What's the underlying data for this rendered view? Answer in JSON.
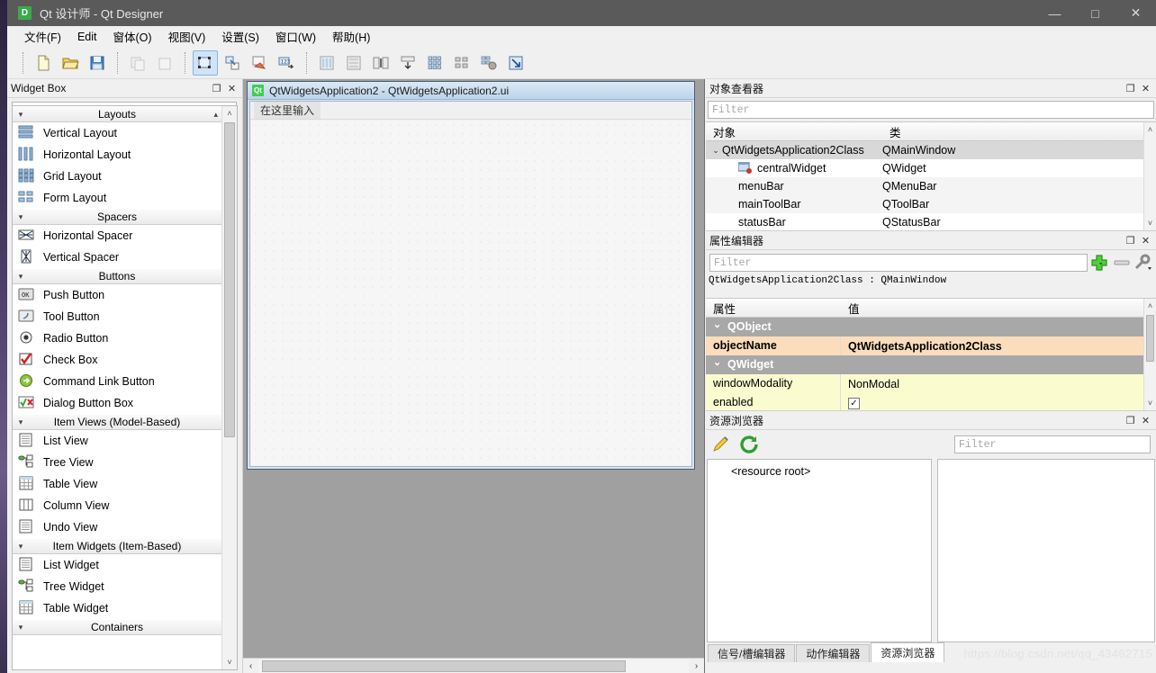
{
  "window": {
    "app_icon": "D",
    "title": "Qt 设计师 - Qt Designer",
    "minimize": "—",
    "maximize": "□",
    "close": "✕"
  },
  "menubar": {
    "items": [
      {
        "name": "file",
        "label": "文件(F)"
      },
      {
        "name": "edit",
        "label": "Edit"
      },
      {
        "name": "form",
        "label": "窗体(O)"
      },
      {
        "name": "view",
        "label": "视图(V)"
      },
      {
        "name": "settings",
        "label": "设置(S)"
      },
      {
        "name": "window",
        "label": "窗口(W)"
      },
      {
        "name": "help",
        "label": "帮助(H)"
      }
    ]
  },
  "toolbar": {
    "groups": [
      {
        "name": "file-ops",
        "buttons": [
          {
            "name": "new-form-button",
            "icon": "new-file-icon",
            "state": "enabled"
          },
          {
            "name": "open-form-button",
            "icon": "open-folder-icon",
            "state": "enabled"
          },
          {
            "name": "save-form-button",
            "icon": "save-disk-icon",
            "state": "enabled"
          }
        ]
      },
      {
        "name": "history-ops",
        "buttons": [
          {
            "name": "undo-button",
            "icon": "undo-icon",
            "state": "disabled"
          },
          {
            "name": "redo-button",
            "icon": "redo-icon",
            "state": "disabled"
          }
        ]
      },
      {
        "name": "mode-ops",
        "buttons": [
          {
            "name": "edit-widgets-button",
            "icon": "edit-widgets-icon",
            "state": "active"
          },
          {
            "name": "edit-signals-slots-button",
            "icon": "signals-slots-icon",
            "state": "enabled"
          },
          {
            "name": "edit-buddies-button",
            "icon": "buddies-icon",
            "state": "enabled"
          },
          {
            "name": "edit-tab-order-button",
            "icon": "tab-order-icon",
            "state": "enabled"
          }
        ]
      },
      {
        "name": "layout-ops",
        "buttons": [
          {
            "name": "layout-horizontally-button",
            "icon": "layout-horizontal-icon",
            "state": "enabled"
          },
          {
            "name": "layout-vertically-button",
            "icon": "layout-vertical-icon",
            "state": "enabled"
          },
          {
            "name": "layout-splitter-horizontal-button",
            "icon": "splitter-horizontal-icon",
            "state": "enabled"
          },
          {
            "name": "layout-splitter-vertical-button",
            "icon": "splitter-vertical-icon",
            "state": "enabled"
          },
          {
            "name": "layout-grid-button",
            "icon": "layout-grid-icon",
            "state": "enabled"
          },
          {
            "name": "layout-form-button",
            "icon": "layout-form-icon",
            "state": "enabled"
          },
          {
            "name": "break-layout-button",
            "icon": "break-layout-icon",
            "state": "enabled"
          },
          {
            "name": "adjust-size-button",
            "icon": "adjust-size-icon",
            "state": "enabled"
          }
        ]
      }
    ]
  },
  "widget_box": {
    "title": "Widget Box",
    "float_label": "❐",
    "close_label": "✕",
    "filter_placeholder": "Filter",
    "filter_value": "",
    "scroll_up": "˄",
    "scroll_down": "˅",
    "categories": [
      {
        "name": "layouts",
        "label": "Layouts",
        "expanded": true,
        "items": [
          {
            "label": "Vertical Layout",
            "icon": "vertical-layout-icon"
          },
          {
            "label": "Horizontal Layout",
            "icon": "horizontal-layout-icon"
          },
          {
            "label": "Grid Layout",
            "icon": "grid-layout-icon"
          },
          {
            "label": "Form Layout",
            "icon": "form-layout-icon"
          }
        ]
      },
      {
        "name": "spacers",
        "label": "Spacers",
        "expanded": true,
        "items": [
          {
            "label": "Horizontal Spacer",
            "icon": "horizontal-spacer-icon"
          },
          {
            "label": "Vertical Spacer",
            "icon": "vertical-spacer-icon"
          }
        ]
      },
      {
        "name": "buttons",
        "label": "Buttons",
        "expanded": true,
        "items": [
          {
            "label": "Push Button",
            "icon": "push-button-icon"
          },
          {
            "label": "Tool Button",
            "icon": "tool-button-icon"
          },
          {
            "label": "Radio Button",
            "icon": "radio-button-icon"
          },
          {
            "label": "Check Box",
            "icon": "check-box-icon"
          },
          {
            "label": "Command Link Button",
            "icon": "command-link-icon"
          },
          {
            "label": "Dialog Button Box",
            "icon": "dialog-button-box-icon"
          }
        ]
      },
      {
        "name": "item-views",
        "label": "Item Views (Model-Based)",
        "expanded": true,
        "items": [
          {
            "label": "List View",
            "icon": "list-view-icon"
          },
          {
            "label": "Tree View",
            "icon": "tree-view-icon"
          },
          {
            "label": "Table View",
            "icon": "table-view-icon"
          },
          {
            "label": "Column View",
            "icon": "column-view-icon"
          },
          {
            "label": "Undo View",
            "icon": "undo-view-icon"
          }
        ]
      },
      {
        "name": "item-widgets",
        "label": "Item Widgets (Item-Based)",
        "expanded": true,
        "items": [
          {
            "label": "List Widget",
            "icon": "list-widget-icon"
          },
          {
            "label": "Tree Widget",
            "icon": "tree-widget-icon"
          },
          {
            "label": "Table Widget",
            "icon": "table-widget-icon"
          }
        ]
      },
      {
        "name": "containers",
        "label": "Containers",
        "expanded": true,
        "items": []
      }
    ]
  },
  "form_editor": {
    "window_title": "QtWidgetsApplication2 - QtWidgetsApplication2.ui",
    "qt_icon": "Qt",
    "menubar_placeholder": "在这里输入",
    "hscroll_left": "‹",
    "hscroll_right": "›"
  },
  "object_inspector": {
    "title": "对象查看器",
    "float_label": "❐",
    "close_label": "✕",
    "filter_placeholder": "Filter",
    "filter_value": "",
    "columns": [
      "对象",
      "类"
    ],
    "scroll_up": "˄",
    "scroll_down": "˅",
    "rows": [
      {
        "name": "QtWidgetsApplication2Class",
        "class": "QMainWindow",
        "depth": 0,
        "selected": true,
        "expander": "⌄",
        "icon": ""
      },
      {
        "name": "centralWidget",
        "class": "QWidget",
        "depth": 1,
        "selected": false,
        "expander": "",
        "icon": "widget-icon"
      },
      {
        "name": "menuBar",
        "class": "QMenuBar",
        "depth": 1,
        "selected": false,
        "expander": "",
        "icon": ""
      },
      {
        "name": "mainToolBar",
        "class": "QToolBar",
        "depth": 1,
        "selected": false,
        "expander": "",
        "icon": ""
      },
      {
        "name": "statusBar",
        "class": "QStatusBar",
        "depth": 1,
        "selected": false,
        "expander": "",
        "icon": ""
      }
    ]
  },
  "property_editor": {
    "title": "属性编辑器",
    "float_label": "❐",
    "close_label": "✕",
    "filter_placeholder": "Filter",
    "filter_value": "",
    "add_button_icon": "plus-icon",
    "remove_button_icon": "minus-icon",
    "configure_button_icon": "wrench-icon",
    "object_line": "QtWidgetsApplication2Class : QMainWindow",
    "columns": [
      "属性",
      "值"
    ],
    "scroll_up": "˄",
    "scroll_down": "˅",
    "rows": [
      {
        "kind": "group",
        "key": "QObject",
        "value": ""
      },
      {
        "kind": "highlight",
        "key": "objectName",
        "value": "QtWidgetsApplication2Class"
      },
      {
        "kind": "group",
        "key": "QWidget",
        "value": ""
      },
      {
        "kind": "yellow",
        "key": "windowModality",
        "value": "NonModal"
      },
      {
        "kind": "yellow-check",
        "key": "enabled",
        "value": "✓"
      }
    ]
  },
  "resource_browser": {
    "title": "资源浏览器",
    "float_label": "❐",
    "close_label": "✕",
    "edit_button_icon": "pencil-icon",
    "reload_button_icon": "reload-icon",
    "filter_placeholder": "Filter",
    "filter_value": "",
    "tree_root": "<resource root>",
    "tabs": [
      {
        "name": "signal-slot-editor",
        "label": "信号/槽编辑器",
        "active": false
      },
      {
        "name": "action-editor",
        "label": "动作编辑器",
        "active": false
      },
      {
        "name": "resource-browser",
        "label": "资源浏览器",
        "active": true
      }
    ]
  },
  "watermark": {
    "text": "https://blog.csdn.net/qq_43462715"
  },
  "colors": {
    "titlebar": "#5a5a5a",
    "accent_green": "#41cd52",
    "mdi_background": "#a0a0a0",
    "property_highlight": "#fbddbc",
    "property_yellow": "#fbfbd0",
    "selection_gray": "#d8d8d8"
  }
}
